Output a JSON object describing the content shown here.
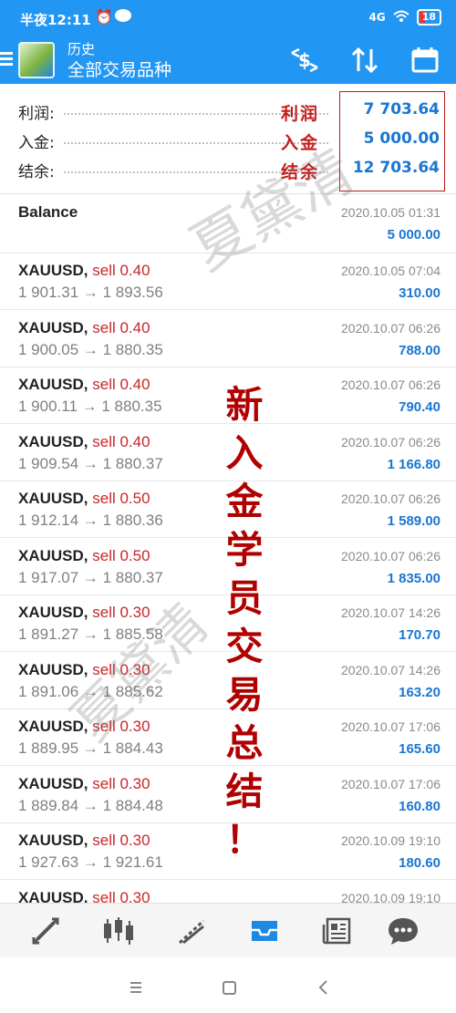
{
  "status_bar": {
    "time": "半夜12:11",
    "battery": "18",
    "signal": "4G"
  },
  "header": {
    "subtitle": "历史",
    "title": "全部交易品种",
    "icons": [
      "currency-swap-icon",
      "sort-icon",
      "calendar-icon"
    ]
  },
  "summary": {
    "profit_label": "利润:",
    "profit_value": "7 703.64",
    "deposit_label": "入金:",
    "deposit_value": "5 000.00",
    "balance_label": "结余:",
    "balance_value": "12 703.64"
  },
  "annotation": {
    "profit": "利润",
    "deposit": "入金",
    "balance": "结余",
    "vertical": [
      "新",
      "入",
      "金",
      "学",
      "员",
      "交",
      "易",
      "总",
      "结",
      "！"
    ]
  },
  "watermark": "夏黛清",
  "balance_row": {
    "label": "Balance",
    "date": "2020.10.05 01:31",
    "amount": "5 000.00"
  },
  "trades": [
    {
      "symbol": "XAUUSD,",
      "side": "sell 0.40",
      "prices": "1 901.31 → 1 893.56",
      "date": "2020.10.05 07:04",
      "profit": "310.00"
    },
    {
      "symbol": "XAUUSD,",
      "side": "sell 0.40",
      "prices": "1 900.05 → 1 880.35",
      "date": "2020.10.07 06:26",
      "profit": "788.00"
    },
    {
      "symbol": "XAUUSD,",
      "side": "sell 0.40",
      "prices": "1 900.11 → 1 880.35",
      "date": "2020.10.07 06:26",
      "profit": "790.40"
    },
    {
      "symbol": "XAUUSD,",
      "side": "sell 0.40",
      "prices": "1 909.54 → 1 880.37",
      "date": "2020.10.07 06:26",
      "profit": "1 166.80"
    },
    {
      "symbol": "XAUUSD,",
      "side": "sell 0.50",
      "prices": "1 912.14 → 1 880.36",
      "date": "2020.10.07 06:26",
      "profit": "1 589.00"
    },
    {
      "symbol": "XAUUSD,",
      "side": "sell 0.50",
      "prices": "1 917.07 → 1 880.37",
      "date": "2020.10.07 06:26",
      "profit": "1 835.00"
    },
    {
      "symbol": "XAUUSD,",
      "side": "sell 0.30",
      "prices": "1 891.27 → 1 885.58",
      "date": "2020.10.07 14:26",
      "profit": "170.70"
    },
    {
      "symbol": "XAUUSD,",
      "side": "sell 0.30",
      "prices": "1 891.06 → 1 885.62",
      "date": "2020.10.07 14:26",
      "profit": "163.20"
    },
    {
      "symbol": "XAUUSD,",
      "side": "sell 0.30",
      "prices": "1 889.95 → 1 884.43",
      "date": "2020.10.07 17:06",
      "profit": "165.60"
    },
    {
      "symbol": "XAUUSD,",
      "side": "sell 0.30",
      "prices": "1 889.84 → 1 884.48",
      "date": "2020.10.07 17:06",
      "profit": "160.80"
    },
    {
      "symbol": "XAUUSD,",
      "side": "sell 0.30",
      "prices": "1 927.63 → 1 921.61",
      "date": "2020.10.09 19:10",
      "profit": "180.60"
    },
    {
      "symbol": "XAUUSD,",
      "side": "sell 0.30",
      "prices": "",
      "date": "2020.10.09 19:10",
      "profit": ""
    }
  ],
  "bottom_nav": [
    {
      "icon": "quotes-icon",
      "active": false
    },
    {
      "icon": "chart-icon",
      "active": false
    },
    {
      "icon": "trade-icon",
      "active": false
    },
    {
      "icon": "history-icon",
      "active": true
    },
    {
      "icon": "news-icon",
      "active": false
    },
    {
      "icon": "chat-icon",
      "active": false
    }
  ],
  "colors": {
    "primary": "#2196f3",
    "profit_blue": "#1976d2",
    "sell_red": "#c62828",
    "annotation_red": "#b00000"
  }
}
